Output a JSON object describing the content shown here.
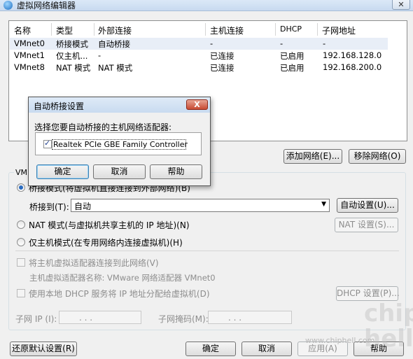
{
  "window": {
    "title": "虚拟网络编辑器",
    "close_glyph": "✕"
  },
  "table": {
    "headers": [
      "名称",
      "类型",
      "外部连接",
      "主机连接",
      "DHCP",
      "子网地址"
    ],
    "rows": [
      [
        "VMnet0",
        "桥接模式",
        "自动桥接",
        "-",
        "-",
        "-"
      ],
      [
        "VMnet1",
        "仅主机...",
        "-",
        "已连接",
        "已启用",
        "192.168.128.0"
      ],
      [
        "VMnet8",
        "NAT 模式",
        "NAT 模式",
        "已连接",
        "已启用",
        "192.168.200.0"
      ]
    ]
  },
  "buttons": {
    "add_network": "添加网络(E)...",
    "remove_network": "移除网络(O)",
    "auto_settings": "自动设置(U)...",
    "nat_settings": "NAT 设置(S)...",
    "dhcp_settings": "DHCP 设置(P)...",
    "restore_defaults": "还原默认设置(R)",
    "ok": "确定",
    "cancel": "取消",
    "apply": "应用(A)",
    "help": "帮助"
  },
  "group": {
    "label": "VMn",
    "bridged_label": "桥接模式(将虚拟机直接连接到外部网络)(B)",
    "bridge_to_label": "桥接到(T):",
    "bridge_to_value": "自动",
    "nat_label": "NAT 模式(与虚拟机共享主机的 IP 地址)(N)",
    "hostonly_label": "仅主机模式(在专用网络内连接虚拟机)(H)",
    "connect_adapter_label": "将主机虚拟适配器连接到此网络(V)",
    "adapter_name_label": "主机虚拟适配器名称: VMware 网络适配器 VMnet0",
    "dhcp_label": "使用本地 DHCP 服务将 IP 地址分配给虚拟机(D)",
    "subnet_ip_label": "子网 IP (I):",
    "subnet_mask_label": "子网掩码(M):",
    "ip_dots": ". . ."
  },
  "dialog": {
    "title": "自动桥接设置",
    "close_glyph": "X",
    "prompt": "选择您要自动桥接的主机网络适配器:",
    "adapter": "Realtek PCIe GBE Family Controller",
    "ok": "确定",
    "cancel": "取消",
    "help": "帮助"
  },
  "watermark": {
    "url": "www.chiphell.com",
    "logo": "chip\nhell"
  },
  "icons": {
    "app": "network-editor-icon",
    "dropdown": "chevron-down-icon"
  }
}
